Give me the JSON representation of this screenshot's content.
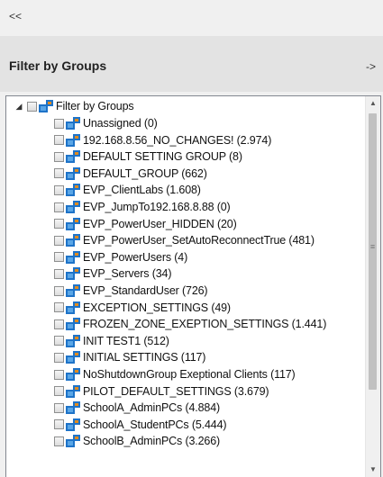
{
  "topbar": {
    "collapse_label": "<<"
  },
  "header": {
    "title": "Filter by Groups",
    "arrow_label": "->"
  },
  "tree": {
    "root": {
      "label": "Filter by Groups",
      "expander": "◢"
    },
    "items": [
      "Unassigned (0)",
      "192.168.8.56_NO_CHANGES! (2.974)",
      "DEFAULT SETTING GROUP (8)",
      "DEFAULT_GROUP (662)",
      "EVP_ClientLabs (1.608)",
      "EVP_JumpTo192.168.8.88 (0)",
      "EVP_PowerUser_HIDDEN (20)",
      "EVP_PowerUser_SetAutoReconnectTrue (481)",
      "EVP_PowerUsers (4)",
      "EVP_Servers (34)",
      "EVP_StandardUser (726)",
      "EXCEPTION_SETTINGS (49)",
      "FROZEN_ZONE_EXEPTION_SETTINGS (1.441)",
      "INIT TEST1 (512)",
      "INITIAL SETTINGS (117)",
      "NoShutdownGroup Exeptional Clients (117)",
      "PILOT_DEFAULT_SETTINGS (3.679)",
      "SchoolA_AdminPCs (4.884)",
      "SchoolA_StudentPCs (5.444)",
      "SchoolB_AdminPCs (3.266)"
    ]
  },
  "scrollbar": {
    "up": "▲",
    "down": "▼",
    "grip": "≡"
  },
  "colors": {
    "icon_blue": "#1e73c8",
    "icon_light": "#5aa6e6",
    "icon_orange": "#e08a1e"
  }
}
